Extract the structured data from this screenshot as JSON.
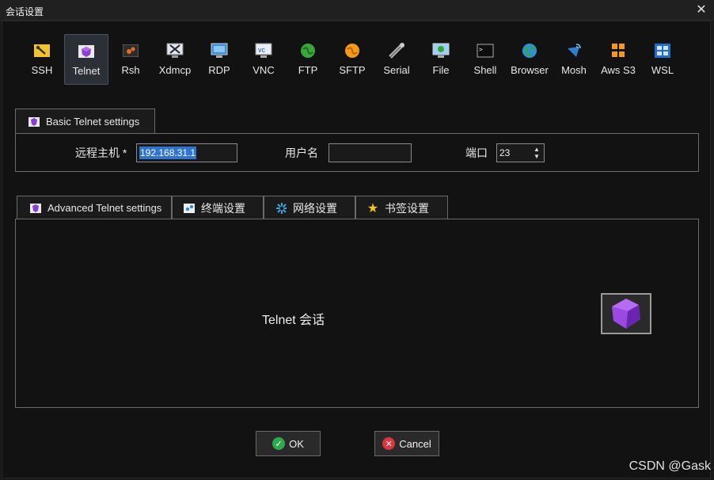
{
  "window": {
    "title": "会话设置"
  },
  "protocols": [
    {
      "label": "SSH",
      "icon": "wrench-icon"
    },
    {
      "label": "Telnet",
      "icon": "telnet-icon"
    },
    {
      "label": "Rsh",
      "icon": "rsh-icon"
    },
    {
      "label": "Xdmcp",
      "icon": "xdmcp-icon"
    },
    {
      "label": "RDP",
      "icon": "rdp-icon"
    },
    {
      "label": "VNC",
      "icon": "vnc-icon"
    },
    {
      "label": "FTP",
      "icon": "ftp-icon"
    },
    {
      "label": "SFTP",
      "icon": "sftp-icon"
    },
    {
      "label": "Serial",
      "icon": "serial-icon"
    },
    {
      "label": "File",
      "icon": "file-icon"
    },
    {
      "label": "Shell",
      "icon": "shell-icon"
    },
    {
      "label": "Browser",
      "icon": "browser-icon"
    },
    {
      "label": "Mosh",
      "icon": "mosh-icon"
    },
    {
      "label": "Aws S3",
      "icon": "aws-s3-icon"
    },
    {
      "label": "WSL",
      "icon": "wsl-icon"
    }
  ],
  "basic": {
    "tab_label": "Basic Telnet settings",
    "remote_host_label": "远程主机 *",
    "remote_host_value": "192.168.31.1",
    "username_label": "用户名",
    "username_value": "",
    "port_label": "端口",
    "port_value": "23"
  },
  "advanced_tabs": [
    {
      "label": "Advanced Telnet settings",
      "icon": "telnet-icon"
    },
    {
      "label": "终端设置",
      "icon": "terminal-settings-icon"
    },
    {
      "label": "网络设置",
      "icon": "network-icon"
    },
    {
      "label": "书签设置",
      "icon": "star-icon"
    }
  ],
  "session": {
    "description": "Telnet 会话",
    "icon": "telnet-gem-icon"
  },
  "buttons": {
    "ok": "OK",
    "cancel": "Cancel"
  },
  "watermark": "CSDN @Gask",
  "colors": {
    "selection": "#2f74d0",
    "active_bg": "#2b2f36",
    "ok_green": "#2fa84f",
    "cancel_red": "#d9363e",
    "gem_purple": "#8a3fd1"
  }
}
